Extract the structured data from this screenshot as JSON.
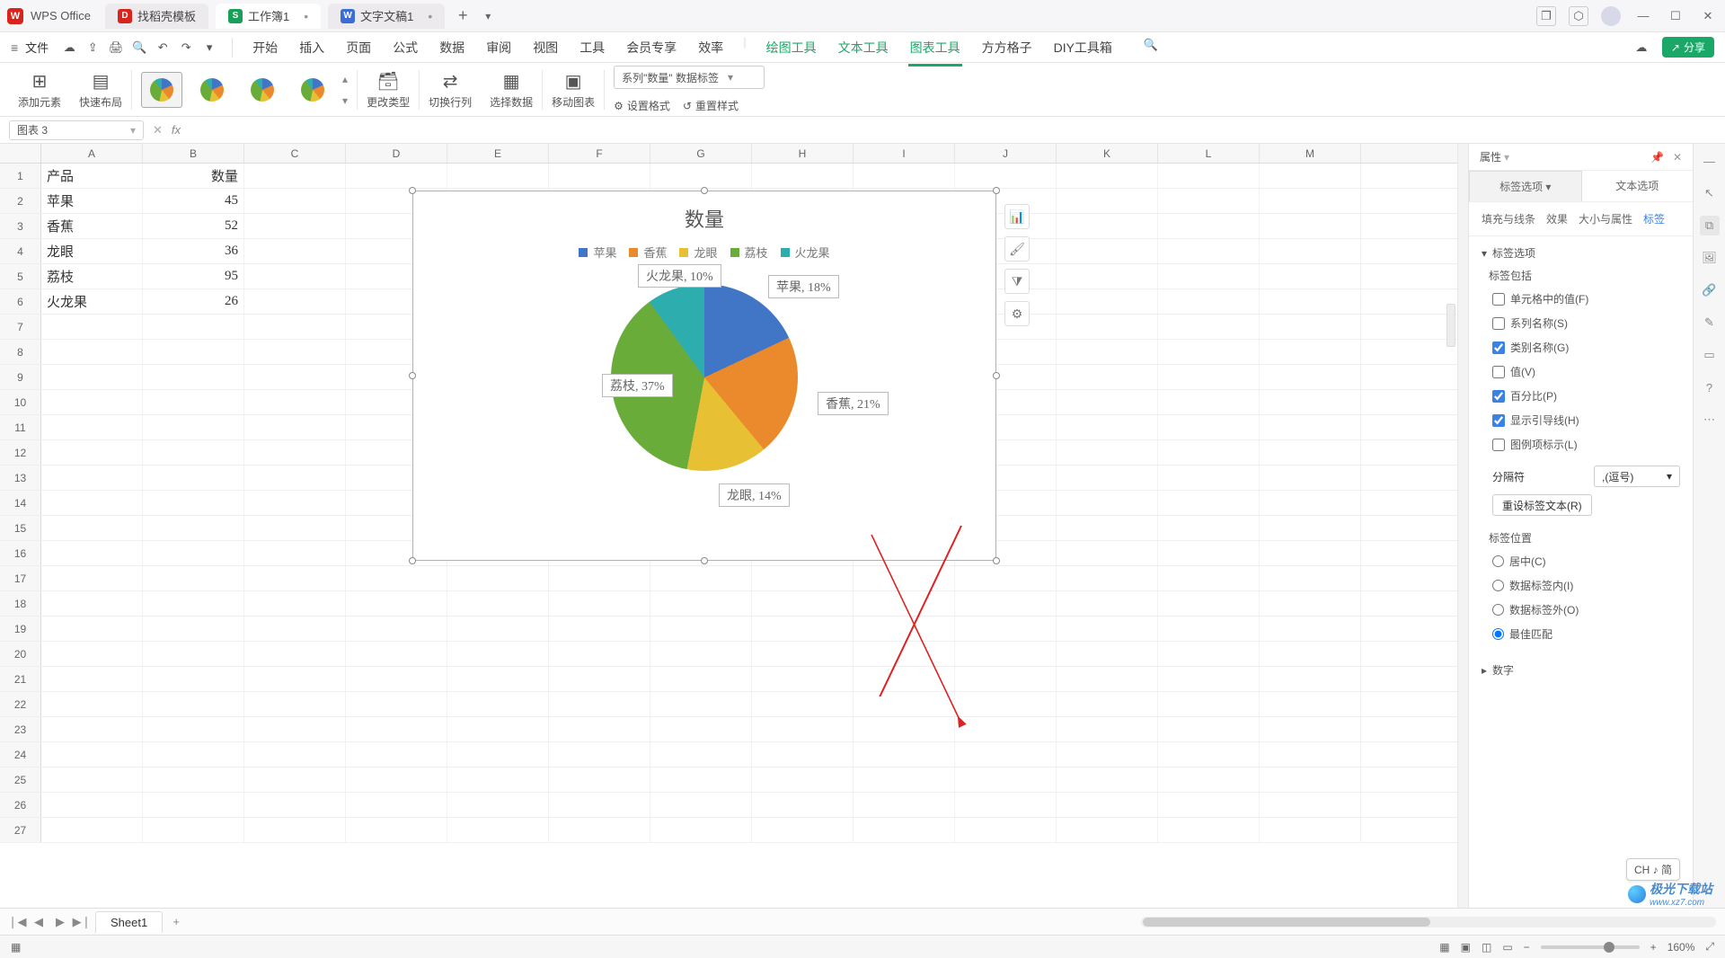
{
  "titlebar": {
    "app": "WPS Office",
    "tabs": [
      {
        "icon": "d",
        "label": "找稻壳模板"
      },
      {
        "icon": "s",
        "label": "工作簿1",
        "active": true
      },
      {
        "icon": "w",
        "label": "文字文稿1"
      }
    ]
  },
  "topmenu": {
    "file": "文件",
    "items": [
      "开始",
      "插入",
      "页面",
      "公式",
      "数据",
      "审阅",
      "视图",
      "工具",
      "会员专享",
      "效率"
    ],
    "green_items": [
      "绘图工具",
      "文本工具",
      "图表工具",
      "方方格子",
      "DIY工具箱"
    ],
    "active": "图表工具",
    "share": "分享"
  },
  "ribbon": {
    "add_element": "添加元素",
    "quick_layout": "快速布局",
    "change_type": "更改类型",
    "switch_rc": "切换行列",
    "select_data": "选择数据",
    "move_chart": "移动图表",
    "series_combo": "系列\"数量\" 数据标签",
    "set_format": "设置格式",
    "reset_style": "重置样式"
  },
  "namebox": {
    "value": "图表 3",
    "fx": "fx"
  },
  "columns": [
    "A",
    "B",
    "C",
    "D",
    "E",
    "F",
    "G",
    "H",
    "I",
    "J",
    "K",
    "L",
    "M"
  ],
  "table": {
    "rows": [
      [
        "产品",
        "数量"
      ],
      [
        "苹果",
        "45"
      ],
      [
        "香蕉",
        "52"
      ],
      [
        "龙眼",
        "36"
      ],
      [
        "荔枝",
        "95"
      ],
      [
        "火龙果",
        "26"
      ]
    ]
  },
  "chart_data": {
    "type": "pie",
    "title": "数量",
    "legend": [
      "苹果",
      "香蕉",
      "龙眼",
      "荔枝",
      "火龙果"
    ],
    "series": [
      {
        "name": "数量",
        "categories": [
          "苹果",
          "香蕉",
          "龙眼",
          "荔枝",
          "火龙果"
        ],
        "values": [
          45,
          52,
          36,
          95,
          26
        ],
        "percent": [
          18,
          21,
          14,
          37,
          10
        ]
      }
    ],
    "colors": {
      "苹果": "#4076c5",
      "香蕉": "#ea8a2c",
      "龙眼": "#e7c033",
      "荔枝": "#6aac3a",
      "火龙果": "#2eadaf"
    },
    "labels": [
      "苹果, 18%",
      "香蕉, 21%",
      "龙眼, 14%",
      "荔枝, 37%",
      "火龙果, 10%"
    ]
  },
  "rightpane": {
    "title": "属性",
    "tab_label": "标签选项",
    "tab_text": "文本选项",
    "subtabs": [
      "填充与线条",
      "效果",
      "大小与属性",
      "标签"
    ],
    "sub_active": "标签",
    "sec1": "标签选项",
    "group1": "标签包括",
    "opts": [
      {
        "label": "单元格中的值(F)",
        "checked": false
      },
      {
        "label": "系列名称(S)",
        "checked": false
      },
      {
        "label": "类别名称(G)",
        "checked": true
      },
      {
        "label": "值(V)",
        "checked": false
      },
      {
        "label": "百分比(P)",
        "checked": true
      },
      {
        "label": "显示引导线(H)",
        "checked": true
      },
      {
        "label": "图例项标示(L)",
        "checked": false
      }
    ],
    "sep_label": "分隔符",
    "sep_value": ",(逗号)",
    "reset_btn": "重设标签文本(R)",
    "pos_title": "标签位置",
    "positions": [
      {
        "label": "居中(C)"
      },
      {
        "label": "数据标签内(I)"
      },
      {
        "label": "数据标签外(O)"
      },
      {
        "label": "最佳匹配",
        "checked": true
      }
    ],
    "sec_number": "数字"
  },
  "sheettab": "Sheet1",
  "status": {
    "zoom": "160%",
    "ime": "CH ♪ 简"
  },
  "watermark": {
    "name": "极光下载站",
    "url": "www.xz7.com"
  }
}
